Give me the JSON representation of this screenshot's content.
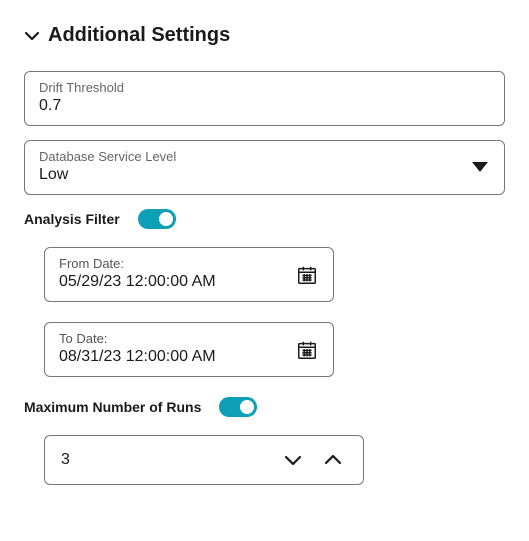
{
  "section": {
    "title": "Additional Settings"
  },
  "drift": {
    "label": "Drift Threshold",
    "value": "0.7"
  },
  "dbService": {
    "label": "Database Service Level",
    "value": "Low"
  },
  "analysisFilter": {
    "label": "Analysis Filter",
    "on": true
  },
  "fromDate": {
    "label": "From Date:",
    "value": "05/29/23 12:00:00 AM"
  },
  "toDate": {
    "label": "To Date:",
    "value": "08/31/23 12:00:00 AM"
  },
  "maxRuns": {
    "label": "Maximum Number of Runs",
    "on": true,
    "value": "3"
  }
}
